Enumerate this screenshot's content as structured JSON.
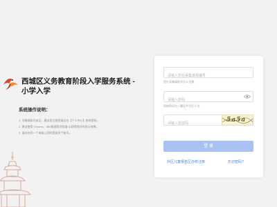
{
  "header": {
    "title_line1": "西城区义务教育阶段入学服务系统 -",
    "title_line2": "小学入学"
  },
  "notes": {
    "title": "系统操作说明：",
    "items": [
      "1. 为确保账号安全，建议您注册登录后在【个人中心】修改密码。",
      "2. 建议使用 Chrome、360极速版浏览器 以获得良好的显示效果。",
      "3. 请勿在同一个电脑上同时登录多个账号。"
    ]
  },
  "login": {
    "account_placeholder": "请输入您在采集填报编号",
    "account_hint": "您在采集填报号为 8 位数",
    "password_placeholder": "请输入密码",
    "password_hint": "初始密码为入籍证件号后 6 位",
    "captcha_placeholder": "请输入验证码",
    "captcha_text": "5a5a",
    "button_label": "登 录",
    "register_link": "外区儿童报名区办校注册",
    "forgot_link": "忘记密码?"
  },
  "colors": {
    "accent": "#a7c1f3",
    "link": "#4d7fd6",
    "background": "#f2f2f2"
  },
  "icons": {
    "logo": "bird-logo-icon",
    "password_toggle": "eye-icon",
    "decoration": "pagoda-icon"
  }
}
